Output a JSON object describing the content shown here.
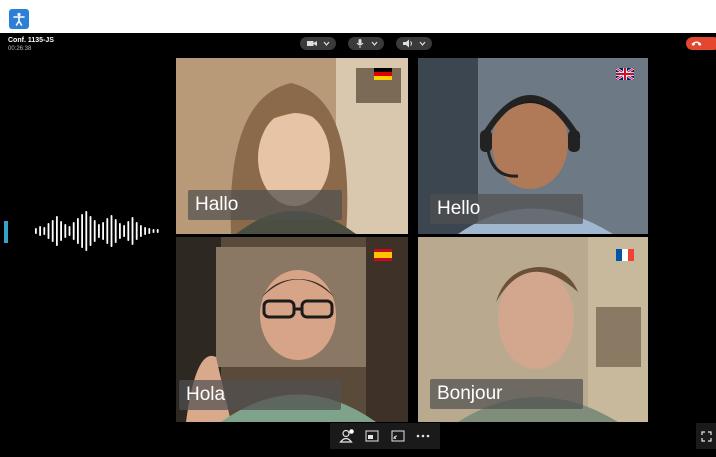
{
  "app": {
    "icon": "accessibility-icon",
    "accent_color": "#2c7fd6"
  },
  "call": {
    "conference_name": "Conf. 1135-JS",
    "elapsed_time": "00:26:38",
    "controls": {
      "camera": "camera-icon",
      "microphone": "microphone-icon",
      "speaker": "speaker-icon",
      "end_call": "hang-up-icon",
      "end_call_color": "#e4472f"
    },
    "speaking_indicator": "sound-wave-icon",
    "participants": [
      {
        "caption": "Hallo",
        "language_flag": "germany-flag-icon"
      },
      {
        "caption": "Hello",
        "language_flag": "united-kingdom-flag-icon"
      },
      {
        "caption": "Hola",
        "language_flag": "spain-flag-icon"
      },
      {
        "caption": "Bonjour",
        "language_flag": "france-flag-icon"
      }
    ],
    "toolbar": [
      "participants-icon",
      "layout-icon",
      "screen-share-icon",
      "more-options-icon"
    ],
    "fullscreen": "fullscreen-icon"
  }
}
